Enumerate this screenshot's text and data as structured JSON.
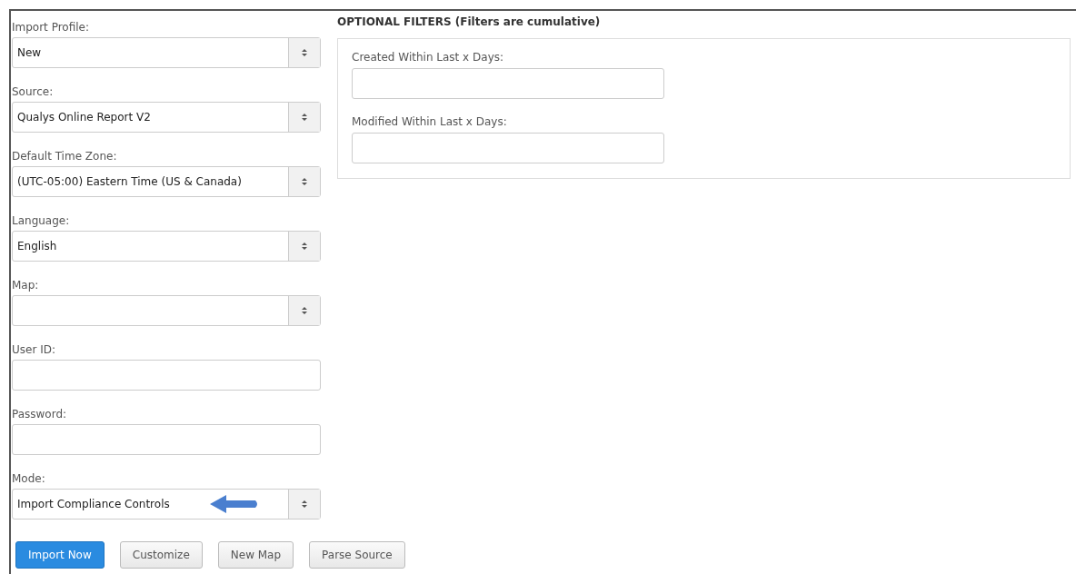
{
  "fields": [
    {
      "label": "Import Profile:",
      "kind": "select",
      "value": "New"
    },
    {
      "label": "Source:",
      "kind": "select",
      "value": "Qualys Online Report V2"
    },
    {
      "label": "Default Time Zone:",
      "kind": "select",
      "value": "(UTC-05:00) Eastern Time (US & Canada)"
    },
    {
      "label": "Language:",
      "kind": "select",
      "value": "English"
    },
    {
      "label": "Map:",
      "kind": "select"
    },
    {
      "label": "User ID:",
      "kind": "text"
    },
    {
      "label": "Password:",
      "kind": "text"
    },
    {
      "label": "Mode:",
      "kind": "select",
      "value": "Import Compliance Controls",
      "callout_arrow": true
    }
  ],
  "buttons": [
    {
      "label": "Import Now",
      "primary": true
    },
    {
      "label": "Customize",
      "primary": false
    },
    {
      "label": "New Map",
      "primary": false
    },
    {
      "label": "Parse Source",
      "primary": false
    }
  ],
  "filters": {
    "title": "OPTIONAL FILTERS (Filters are cumulative)",
    "fields": [
      {
        "label": "Created Within Last x Days:",
        "kind": "text"
      },
      {
        "label": "Modified Within Last x Days:",
        "kind": "text"
      }
    ]
  }
}
